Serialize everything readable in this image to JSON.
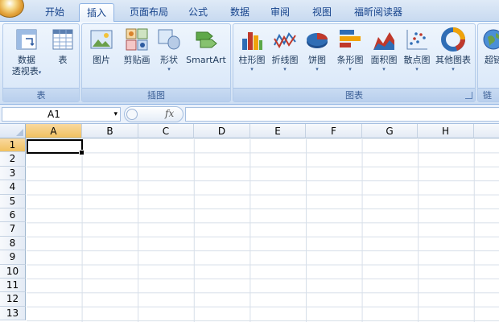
{
  "tabs": [
    {
      "label": "开始",
      "active": false
    },
    {
      "label": "插入",
      "active": true
    },
    {
      "label": "页面布局",
      "active": false
    },
    {
      "label": "公式",
      "active": false
    },
    {
      "label": "数据",
      "active": false
    },
    {
      "label": "审阅",
      "active": false
    },
    {
      "label": "视图",
      "active": false
    },
    {
      "label": "福昕阅读器",
      "active": false
    }
  ],
  "ribbon": {
    "table_group": {
      "label": "表",
      "pivot_line1": "数据",
      "pivot_line2": "透视表",
      "table": "表"
    },
    "illustrations_group": {
      "label": "插图",
      "picture": "图片",
      "clipart": "剪贴画",
      "shapes": "形状",
      "smartart": "SmartArt"
    },
    "charts_group": {
      "label": "图表",
      "column": "柱形图",
      "line": "折线图",
      "pie": "饼图",
      "bar": "条形图",
      "area": "面积图",
      "scatter": "散点图",
      "other": "其他图表"
    },
    "links_group": {
      "label": "链",
      "hyperlink": "超链"
    },
    "dropdown_caret": "▾"
  },
  "formula_bar": {
    "name_box": "A1",
    "fx": "fx",
    "formula": ""
  },
  "columns": [
    "A",
    "B",
    "C",
    "D",
    "E",
    "F",
    "G",
    "H"
  ],
  "rows": [
    "1",
    "2",
    "3",
    "4",
    "5",
    "6",
    "7",
    "8",
    "9",
    "10",
    "11",
    "12",
    "13"
  ],
  "colors": {
    "selected_header": "#f1c15f",
    "ribbon_text": "#15428b"
  }
}
